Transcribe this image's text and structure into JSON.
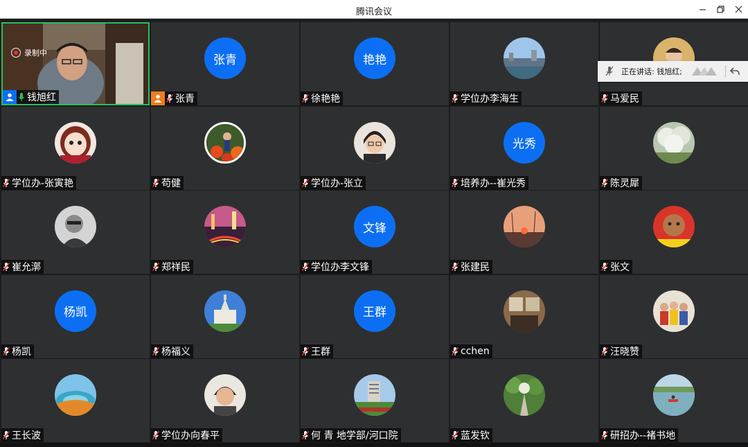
{
  "window": {
    "title": "腾讯会议"
  },
  "recording": {
    "label": "录制中"
  },
  "speaking": {
    "label": "正在讲话: 钱旭红;"
  },
  "colors": {
    "accent": "#0c6ff3",
    "active_border": "#27c05a"
  },
  "participants": [
    {
      "name": "钱旭红",
      "avatar": "video-feed",
      "active": true,
      "host": true
    },
    {
      "name": "张青",
      "avatar": "张青",
      "cohost": true
    },
    {
      "name": "徐艳艳",
      "avatar": "艳艳"
    },
    {
      "name": "学位办李海生",
      "avatar": "photo-river-city"
    },
    {
      "name": "马爱民",
      "avatar": "photo-child"
    },
    {
      "name": "学位办-张寅艳",
      "avatar": "photo-cartoon-girl"
    },
    {
      "name": "苟健",
      "avatar": "photo-flowers"
    },
    {
      "name": "学位办-张立",
      "avatar": "photo-woman-glasses"
    },
    {
      "name": "培养办--崔光秀",
      "avatar": "光秀"
    },
    {
      "name": "陈灵犀",
      "avatar": "photo-blossom-tree"
    },
    {
      "name": "崔允漷",
      "avatar": "photo-man-bw"
    },
    {
      "name": "郑祥民",
      "avatar": "photo-night-city"
    },
    {
      "name": "学位办李文锋",
      "avatar": "文锋"
    },
    {
      "name": "张建民",
      "avatar": "photo-sunset"
    },
    {
      "name": "张文",
      "avatar": "photo-dog"
    },
    {
      "name": "杨凯",
      "avatar": "杨凯"
    },
    {
      "name": "杨福义",
      "avatar": "photo-campus-building"
    },
    {
      "name": "王群",
      "avatar": "王群"
    },
    {
      "name": "cchen",
      "avatar": "photo-interior"
    },
    {
      "name": "汪晓赞",
      "avatar": "photo-group"
    },
    {
      "name": "王长波",
      "avatar": "photo-hot-spring"
    },
    {
      "name": "学位办向春平",
      "avatar": "photo-woman-smile"
    },
    {
      "name": "何 青 地学部/河口院",
      "avatar": "photo-tower"
    },
    {
      "name": "蓝发钦",
      "avatar": "photo-garden-path"
    },
    {
      "name": "研招办--褚书地",
      "avatar": "photo-lake-boat"
    }
  ]
}
